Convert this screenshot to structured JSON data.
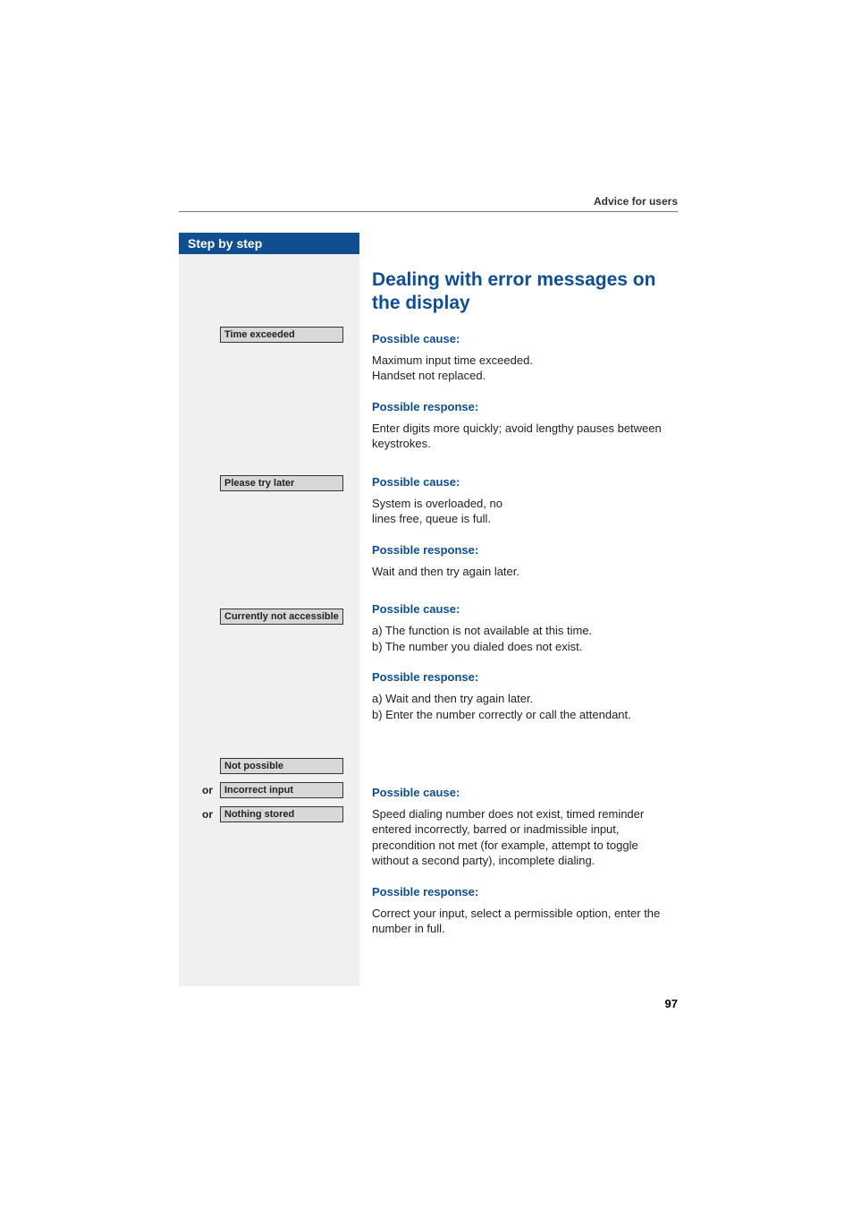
{
  "header": {
    "text": "Advice for users"
  },
  "sidebar": {
    "title": "Step by step",
    "items": [
      {
        "label": "Time exceeded",
        "or": ""
      },
      {
        "label": "Please try later",
        "or": ""
      },
      {
        "label": "Currently not accessible",
        "or": ""
      },
      {
        "label": "Not possible",
        "or": ""
      },
      {
        "label": "Incorrect input",
        "or": "or"
      },
      {
        "label": "Nothing stored",
        "or": "or"
      }
    ]
  },
  "main": {
    "title": "Dealing with error messages on the display",
    "blocks": [
      {
        "cause_h": "Possible cause:",
        "cause": "Maximum input time exceeded.\nHandset not replaced.",
        "resp_h": "Possible response:",
        "resp": "Enter digits more quickly; avoid lengthy pauses between keystrokes."
      },
      {
        "cause_h": "Possible cause:",
        "cause": "System is overloaded, no\nlines free, queue is full.",
        "resp_h": "Possible response:",
        "resp": "Wait and then try again later."
      },
      {
        "cause_h": "Possible cause:",
        "cause": "a) The function is not available at this time.\nb) The number you dialed does not exist.",
        "resp_h": "Possible response:",
        "resp": "a) Wait and then try again later.\nb) Enter the number correctly or call the attendant."
      },
      {
        "cause_h": "Possible cause:",
        "cause": "Speed dialing number does not exist, timed reminder entered incorrectly, barred or inadmissible input, precondition not met (for example, attempt to toggle without a second party), incomplete dialing.",
        "resp_h": "Possible response:",
        "resp": "Correct your input, select a permissible option, enter the number in full."
      }
    ]
  },
  "page_number": "97"
}
